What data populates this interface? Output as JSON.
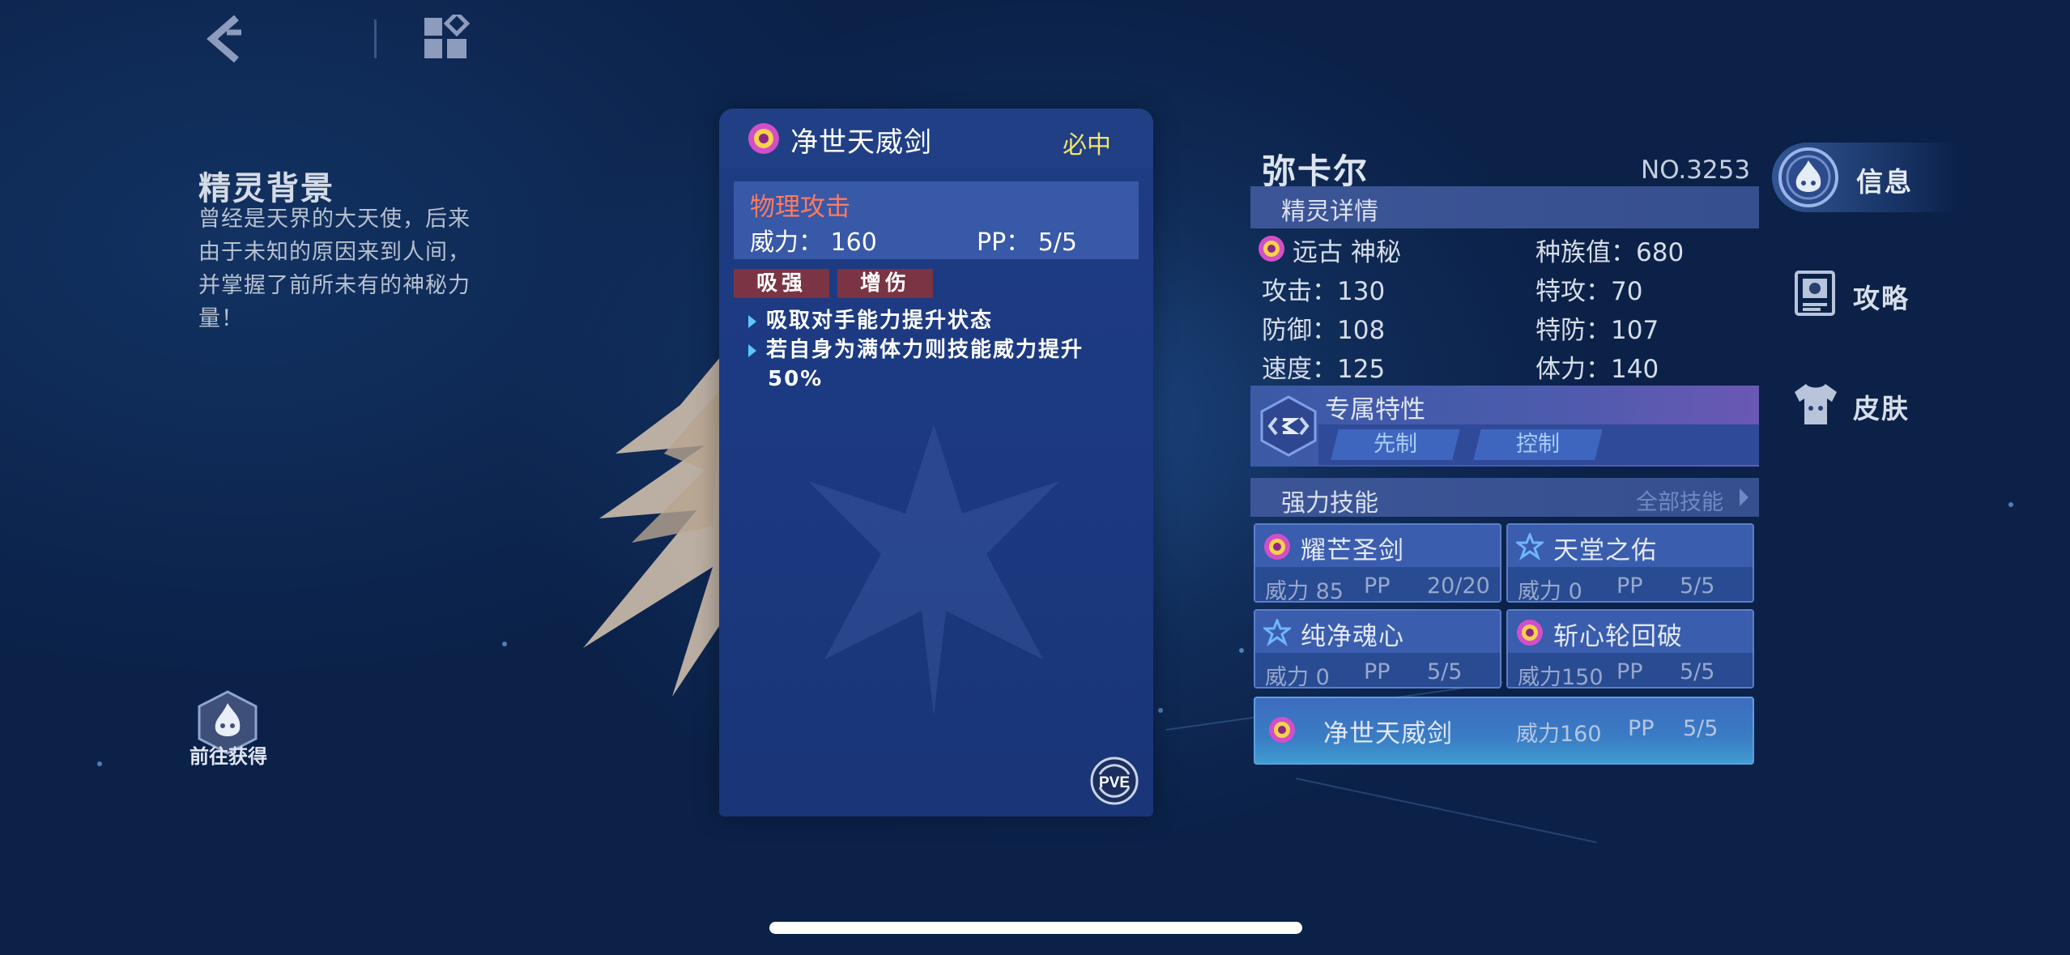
{
  "topbar": {
    "back_icon": "back-chevron-icon",
    "menu_icon": "grid-menu-icon"
  },
  "background": {
    "title": "精灵背景",
    "description": "曾经是天界的大天使，后来由于未知的原因来到人间，并掌握了前所未有的神秘力量！",
    "goto_label": "前往获得"
  },
  "skill_card": {
    "title": "净世天威剑",
    "tag": "必中",
    "category": "物理攻击",
    "power_text": "威力：  160",
    "pp_text": "PP：   5/5",
    "effect_tags": [
      "吸强",
      "增伤"
    ],
    "effects": [
      "吸取对手能力提升状态",
      "若自身为满体力则技能威力提升",
      "50%"
    ],
    "badge": "PVE",
    "type_icon": "spirit-type-icon"
  },
  "pet": {
    "name": "弥卡尔",
    "number": "NO.3253",
    "details_header": "精灵详情",
    "attribute": "远古 神秘",
    "race_value": "种族值：680",
    "stats": {
      "attack": "攻击：130",
      "sp_attack": "特攻：70",
      "defense": "防御：108",
      "sp_defense": "特防：107",
      "speed": "速度：125",
      "hp": "体力：140"
    },
    "trait_title": "专属特性",
    "traits": [
      "先制",
      "控制"
    ],
    "skills_header": "强力技能",
    "skills_all": "全部技能",
    "skills": [
      {
        "name": "耀芒圣剑",
        "power": "威力 85",
        "pp_label": "PP",
        "pp": "20/20",
        "icon": "spirit-type-icon"
      },
      {
        "name": "天堂之佑",
        "power": "威力  0",
        "pp_label": "PP",
        "pp": "  5/5",
        "icon": "star-type-icon"
      },
      {
        "name": "纯净魂心",
        "power": "威力  0",
        "pp_label": "PP",
        "pp": "  5/5",
        "icon": "star-type-icon"
      },
      {
        "name": "斩心轮回破",
        "power": "威力150",
        "pp_label": "PP",
        "pp": "  5/5",
        "icon": "spirit-type-icon"
      }
    ],
    "selected_skill": {
      "name": "净世天威剑",
      "power": "威力160",
      "pp_label": "PP",
      "pp": "5/5"
    }
  },
  "side_nav": [
    {
      "label": "信息",
      "icon": "flame-info-icon",
      "active": true
    },
    {
      "label": "攻略",
      "icon": "guide-book-icon",
      "active": false
    },
    {
      "label": "皮肤",
      "icon": "shirt-skin-icon",
      "active": false
    }
  ],
  "colors": {
    "tag_yellow": "#f2e46a",
    "category_red": "#ff7a5e",
    "effect_tag_bg": "#7b3444",
    "card_bg": "#1f3c82"
  }
}
